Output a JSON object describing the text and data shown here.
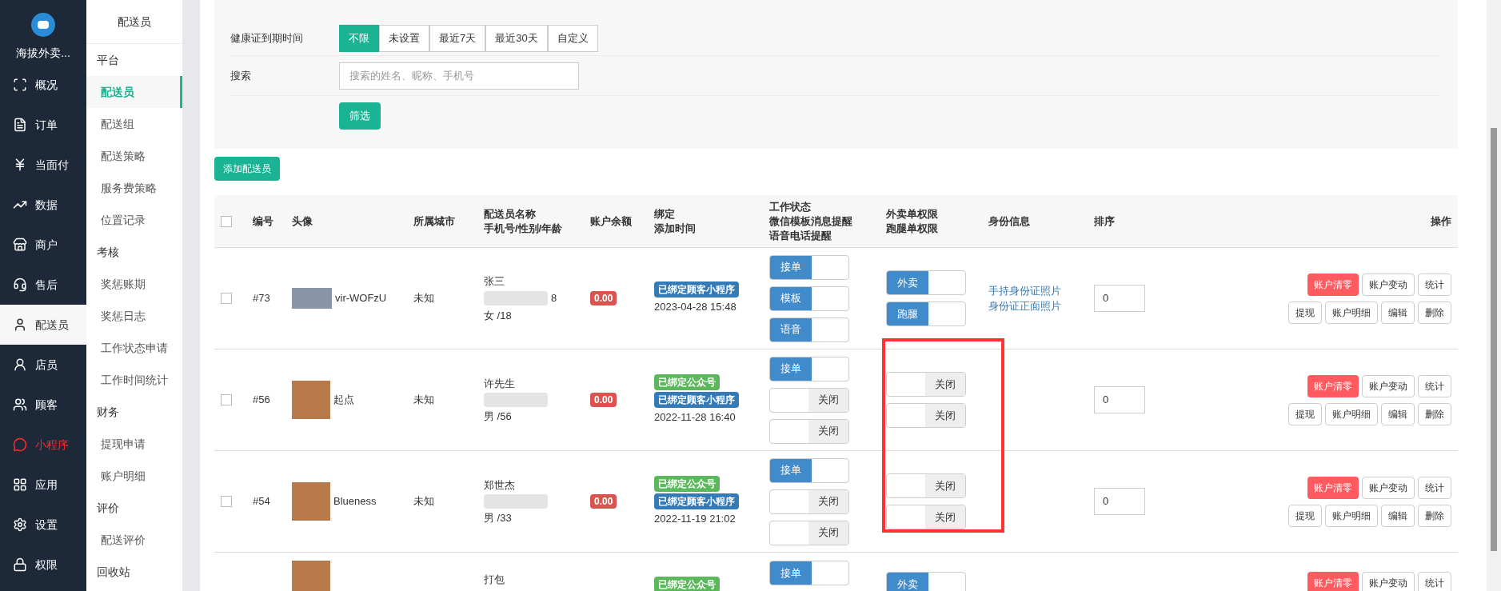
{
  "app": {
    "name": "海拔外卖..."
  },
  "nav": [
    {
      "label": "概况",
      "selected": false,
      "highlighted": false
    },
    {
      "label": "订单",
      "selected": false,
      "highlighted": false
    },
    {
      "label": "当面付",
      "selected": false,
      "highlighted": false
    },
    {
      "label": "数据",
      "selected": false,
      "highlighted": false
    },
    {
      "label": "商户",
      "selected": false,
      "highlighted": false
    },
    {
      "label": "售后",
      "selected": false,
      "highlighted": false
    },
    {
      "label": "配送员",
      "selected": true,
      "highlighted": false
    },
    {
      "label": "店员",
      "selected": false,
      "highlighted": false
    },
    {
      "label": "顾客",
      "selected": false,
      "highlighted": false
    },
    {
      "label": "小程序",
      "selected": false,
      "highlighted": true
    },
    {
      "label": "应用",
      "selected": false,
      "highlighted": false
    },
    {
      "label": "设置",
      "selected": false,
      "highlighted": false
    },
    {
      "label": "权限",
      "selected": false,
      "highlighted": false
    }
  ],
  "subnav": {
    "title": "配送员",
    "groups": [
      {
        "label": "平台",
        "items": [
          {
            "label": "配送员",
            "selected": true
          },
          {
            "label": "配送组",
            "selected": false
          },
          {
            "label": "配送策略",
            "selected": false
          },
          {
            "label": "服务费策略",
            "selected": false
          },
          {
            "label": "位置记录",
            "selected": false
          }
        ]
      },
      {
        "label": "考核",
        "items": [
          {
            "label": "奖惩账期",
            "selected": false
          },
          {
            "label": "奖惩日志",
            "selected": false
          },
          {
            "label": "工作状态申请",
            "selected": false
          },
          {
            "label": "工作时间统计",
            "selected": false
          }
        ]
      },
      {
        "label": "财务",
        "items": [
          {
            "label": "提现申请",
            "selected": false
          },
          {
            "label": "账户明细",
            "selected": false
          }
        ]
      },
      {
        "label": "评价",
        "items": [
          {
            "label": "配送评价",
            "selected": false
          }
        ]
      },
      {
        "label": "回收站"
      }
    ]
  },
  "filters": {
    "health_label": "健康证到期时间",
    "health_options": [
      {
        "label": "不限",
        "selected": true
      },
      {
        "label": "未设置",
        "selected": false
      },
      {
        "label": "最近7天",
        "selected": false
      },
      {
        "label": "最近30天",
        "selected": false
      },
      {
        "label": "自定义",
        "selected": false
      }
    ],
    "search_label": "搜索",
    "search_placeholder": "搜索的姓名、昵称、手机号",
    "submit": "筛选"
  },
  "add_button": "添加配送员",
  "table": {
    "select_all_checked": false,
    "columns": [
      [
        "编号"
      ],
      [
        "头像"
      ],
      [
        "所属城市"
      ],
      [
        "配送员名称",
        "手机号/性别/年龄"
      ],
      [
        "账户余额"
      ],
      [
        "绑定",
        "添加时间"
      ],
      [
        "工作状态",
        "微信模板消息提醒",
        "语音电话提醒"
      ],
      [
        "外卖单权限",
        "跑腿单权限"
      ],
      [
        "身份信息"
      ],
      [
        "排序"
      ],
      [
        "操作"
      ]
    ],
    "rows": [
      {
        "checked": false,
        "id": "#73",
        "nickname": "vir-WOFzU",
        "city": "未知",
        "name": "张三",
        "phone_visible": "8",
        "gender_age": "女 /18",
        "balance": "0.00",
        "badges": [
          {
            "text": "已绑定顾客小程序",
            "kind": "mini"
          }
        ],
        "time": "2023-04-28 15:48",
        "status": [
          {
            "label": "接单",
            "on": true
          },
          {
            "label": "模板",
            "on": true
          },
          {
            "label": "语音",
            "on": true
          }
        ],
        "perms": [
          {
            "label": "外卖",
            "on": true
          },
          {
            "label": "跑腿",
            "on": true
          }
        ],
        "id_links": [
          "手持身份证照片",
          "身份证正面照片"
        ],
        "sort": "0",
        "actions": [
          [
            {
              "label": "账户清零",
              "kind": "danger"
            },
            {
              "label": "账户变动",
              "kind": "default"
            },
            {
              "label": "统计",
              "kind": "default"
            }
          ],
          [
            {
              "label": "提现",
              "kind": "default"
            },
            {
              "label": "账户明细",
              "kind": "default"
            },
            {
              "label": "编辑",
              "kind": "default"
            },
            {
              "label": "删除",
              "kind": "default"
            }
          ]
        ]
      },
      {
        "checked": false,
        "id": "#56",
        "nickname": "起点",
        "city": "未知",
        "name": "许先生",
        "gender_age": "男 /56",
        "balance": "0.00",
        "badges": [
          {
            "text": "已绑定公众号",
            "kind": "official"
          },
          {
            "text": "已绑定顾客小程序",
            "kind": "mini"
          }
        ],
        "time": "2022-11-28 16:40",
        "status": [
          {
            "label": "接单",
            "on": true
          },
          {
            "label": "关闭",
            "on": false
          },
          {
            "label": "关闭",
            "on": false
          }
        ],
        "perms": [
          {
            "label": "关闭",
            "on": false
          },
          {
            "label": "关闭",
            "on": false
          }
        ],
        "sort": "0",
        "actions": [
          [
            {
              "label": "账户清零",
              "kind": "danger"
            },
            {
              "label": "账户变动",
              "kind": "default"
            },
            {
              "label": "统计",
              "kind": "default"
            }
          ],
          [
            {
              "label": "提现",
              "kind": "default"
            },
            {
              "label": "账户明细",
              "kind": "default"
            },
            {
              "label": "编辑",
              "kind": "default"
            },
            {
              "label": "删除",
              "kind": "default"
            }
          ]
        ]
      },
      {
        "checked": false,
        "id": "#54",
        "nickname": "Blueness",
        "city": "未知",
        "name": "郑世杰",
        "gender_age": "男 /33",
        "balance": "0.00",
        "badges": [
          {
            "text": "已绑定公众号",
            "kind": "official"
          },
          {
            "text": "已绑定顾客小程序",
            "kind": "mini"
          }
        ],
        "time": "2022-11-19 21:02",
        "status": [
          {
            "label": "接单",
            "on": true
          },
          {
            "label": "关闭",
            "on": false
          },
          {
            "label": "关闭",
            "on": false
          }
        ],
        "perms": [
          {
            "label": "关闭",
            "on": false
          },
          {
            "label": "关闭",
            "on": false
          }
        ],
        "sort": "0",
        "actions": [
          [
            {
              "label": "账户清零",
              "kind": "danger"
            },
            {
              "label": "账户变动",
              "kind": "default"
            },
            {
              "label": "统计",
              "kind": "default"
            }
          ],
          [
            {
              "label": "提现",
              "kind": "default"
            },
            {
              "label": "账户明细",
              "kind": "default"
            },
            {
              "label": "编辑",
              "kind": "default"
            },
            {
              "label": "删除",
              "kind": "default"
            }
          ]
        ]
      },
      {
        "name": "打包",
        "badges": [
          {
            "text": "已绑定公众号",
            "kind": "official"
          }
        ],
        "status": [
          {
            "label": "接单",
            "on": true
          }
        ],
        "perms": [
          {
            "label": "外卖",
            "on": true
          }
        ],
        "actions": [
          [
            {
              "label": "账户清零",
              "kind": "danger"
            },
            {
              "label": "账户变动",
              "kind": "default"
            },
            {
              "label": "统计",
              "kind": "default"
            }
          ]
        ]
      }
    ]
  }
}
